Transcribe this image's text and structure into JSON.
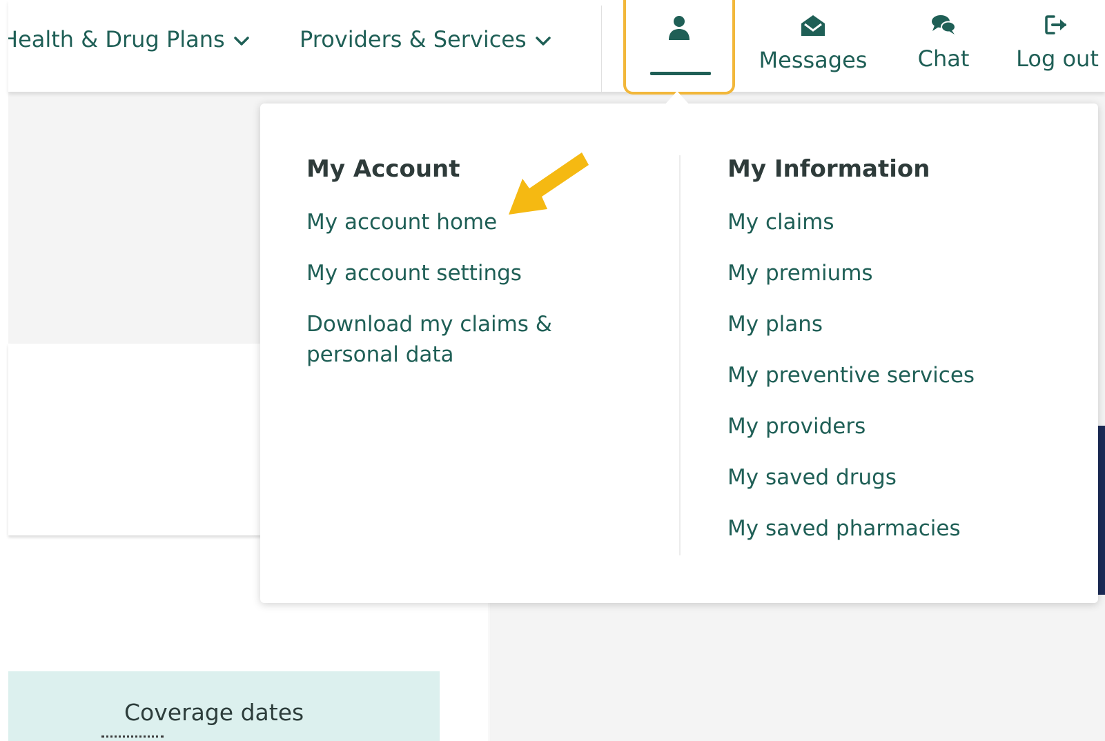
{
  "nav": {
    "health_plans": "Health & Drug Plans",
    "providers_services": "Providers & Services",
    "messages": "Messages",
    "chat": "Chat",
    "logout": "Log out"
  },
  "dropdown": {
    "account_heading": "My Account",
    "account_links": [
      "My account home",
      "My account settings",
      "Download my claims & personal data"
    ],
    "info_heading": "My Information",
    "info_links": [
      "My claims",
      "My premiums",
      "My plans",
      "My preventive services",
      "My providers",
      "My saved drugs",
      "My saved pharmacies"
    ]
  },
  "background": {
    "coverage_label": "Coverage dates"
  },
  "colors": {
    "brand_green": "#1f5f56",
    "highlight_orange": "#f2b73a",
    "annotation_arrow": "#f5b912",
    "navy_accent": "#1b2b57",
    "coverage_bg": "#dcf0ee"
  },
  "icons": {
    "account": "person-icon",
    "messages": "envelope-open-icon",
    "chat": "chat-bubbles-icon",
    "logout": "sign-out-icon",
    "nav_dropdown": "chevron-down-icon"
  }
}
